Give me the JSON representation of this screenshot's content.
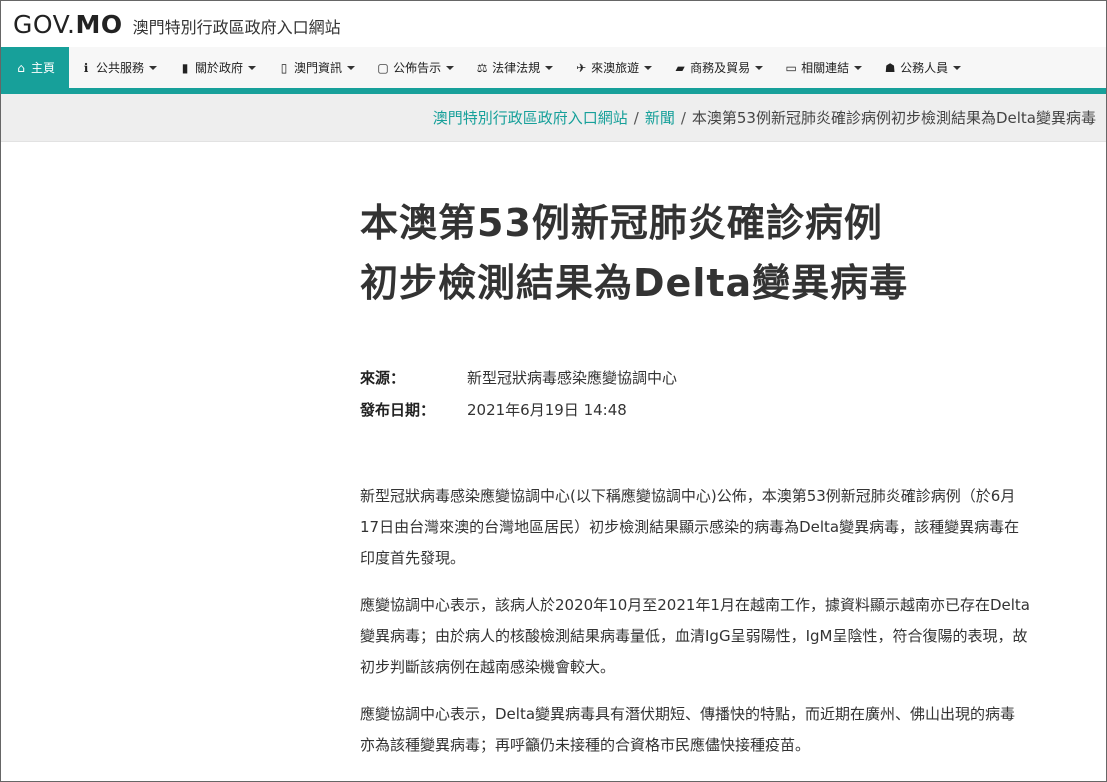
{
  "header": {
    "logo_part1": "GOV.",
    "logo_part2": "MO",
    "site_title": "澳門特別行政區政府入口網站"
  },
  "nav": {
    "items": [
      {
        "label": "主頁",
        "icon": "home-icon",
        "glyph": "⌂"
      },
      {
        "label": "公共服務",
        "icon": "info-icon",
        "glyph": "ℹ"
      },
      {
        "label": "關於政府",
        "icon": "building-icon",
        "glyph": "▮"
      },
      {
        "label": "澳門資訊",
        "icon": "map-icon",
        "glyph": "▯"
      },
      {
        "label": "公佈告示",
        "icon": "notice-icon",
        "glyph": "▢"
      },
      {
        "label": "法律法規",
        "icon": "scale-icon",
        "glyph": "⚖"
      },
      {
        "label": "來澳旅遊",
        "icon": "plane-icon",
        "glyph": "✈"
      },
      {
        "label": "商務及貿易",
        "icon": "briefcase-icon",
        "glyph": "▰"
      },
      {
        "label": "相關連結",
        "icon": "folder-icon",
        "glyph": "▭"
      },
      {
        "label": "公務人員",
        "icon": "users-icon",
        "glyph": "☗"
      }
    ]
  },
  "breadcrumb": {
    "home": "澳門特別行政區政府入口網站",
    "section": "新聞",
    "current": "本澳第53例新冠肺炎確診病例初步檢測結果為Delta變異病毒"
  },
  "article": {
    "title_line1": "本澳第53例新冠肺炎確診病例",
    "title_line2": "初步檢測結果為Delta變異病毒",
    "source_label": "來源：",
    "source_value": "新型冠狀病毒感染應變協調中心",
    "date_label": "發布日期：",
    "date_value": "2021年6月19日 14:48",
    "paragraphs": [
      "新型冠狀病毒感染應變協調中心(以下稱應變協調中心)公佈，本澳第53例新冠肺炎確診病例（於6月17日由台灣來澳的台灣地區居民）初步檢測結果顯示感染的病毒為Delta變異病毒，該種變異病毒在印度首先發現。",
      "應變協調中心表示，該病人於2020年10月至2021年1月在越南工作，據資料顯示越南亦已存在Delta變異病毒；由於病人的核酸檢測結果病毒量低，血清IgG呈弱陽性，IgM呈陰性，符合復陽的表現，故初步判斷該病例在越南感染機會較大。",
      "應變協調中心表示，Delta變異病毒具有潛伏期短、傳播快的特點，而近期在廣州、佛山出現的病毒亦為該種變異病毒；再呼籲仍未接種的合資格市民應儘快接種疫苗。"
    ]
  },
  "colors": {
    "accent": "#17a09a",
    "nav_bg": "#f7f7f7",
    "breadcrumb_bg": "#eeeeee"
  }
}
